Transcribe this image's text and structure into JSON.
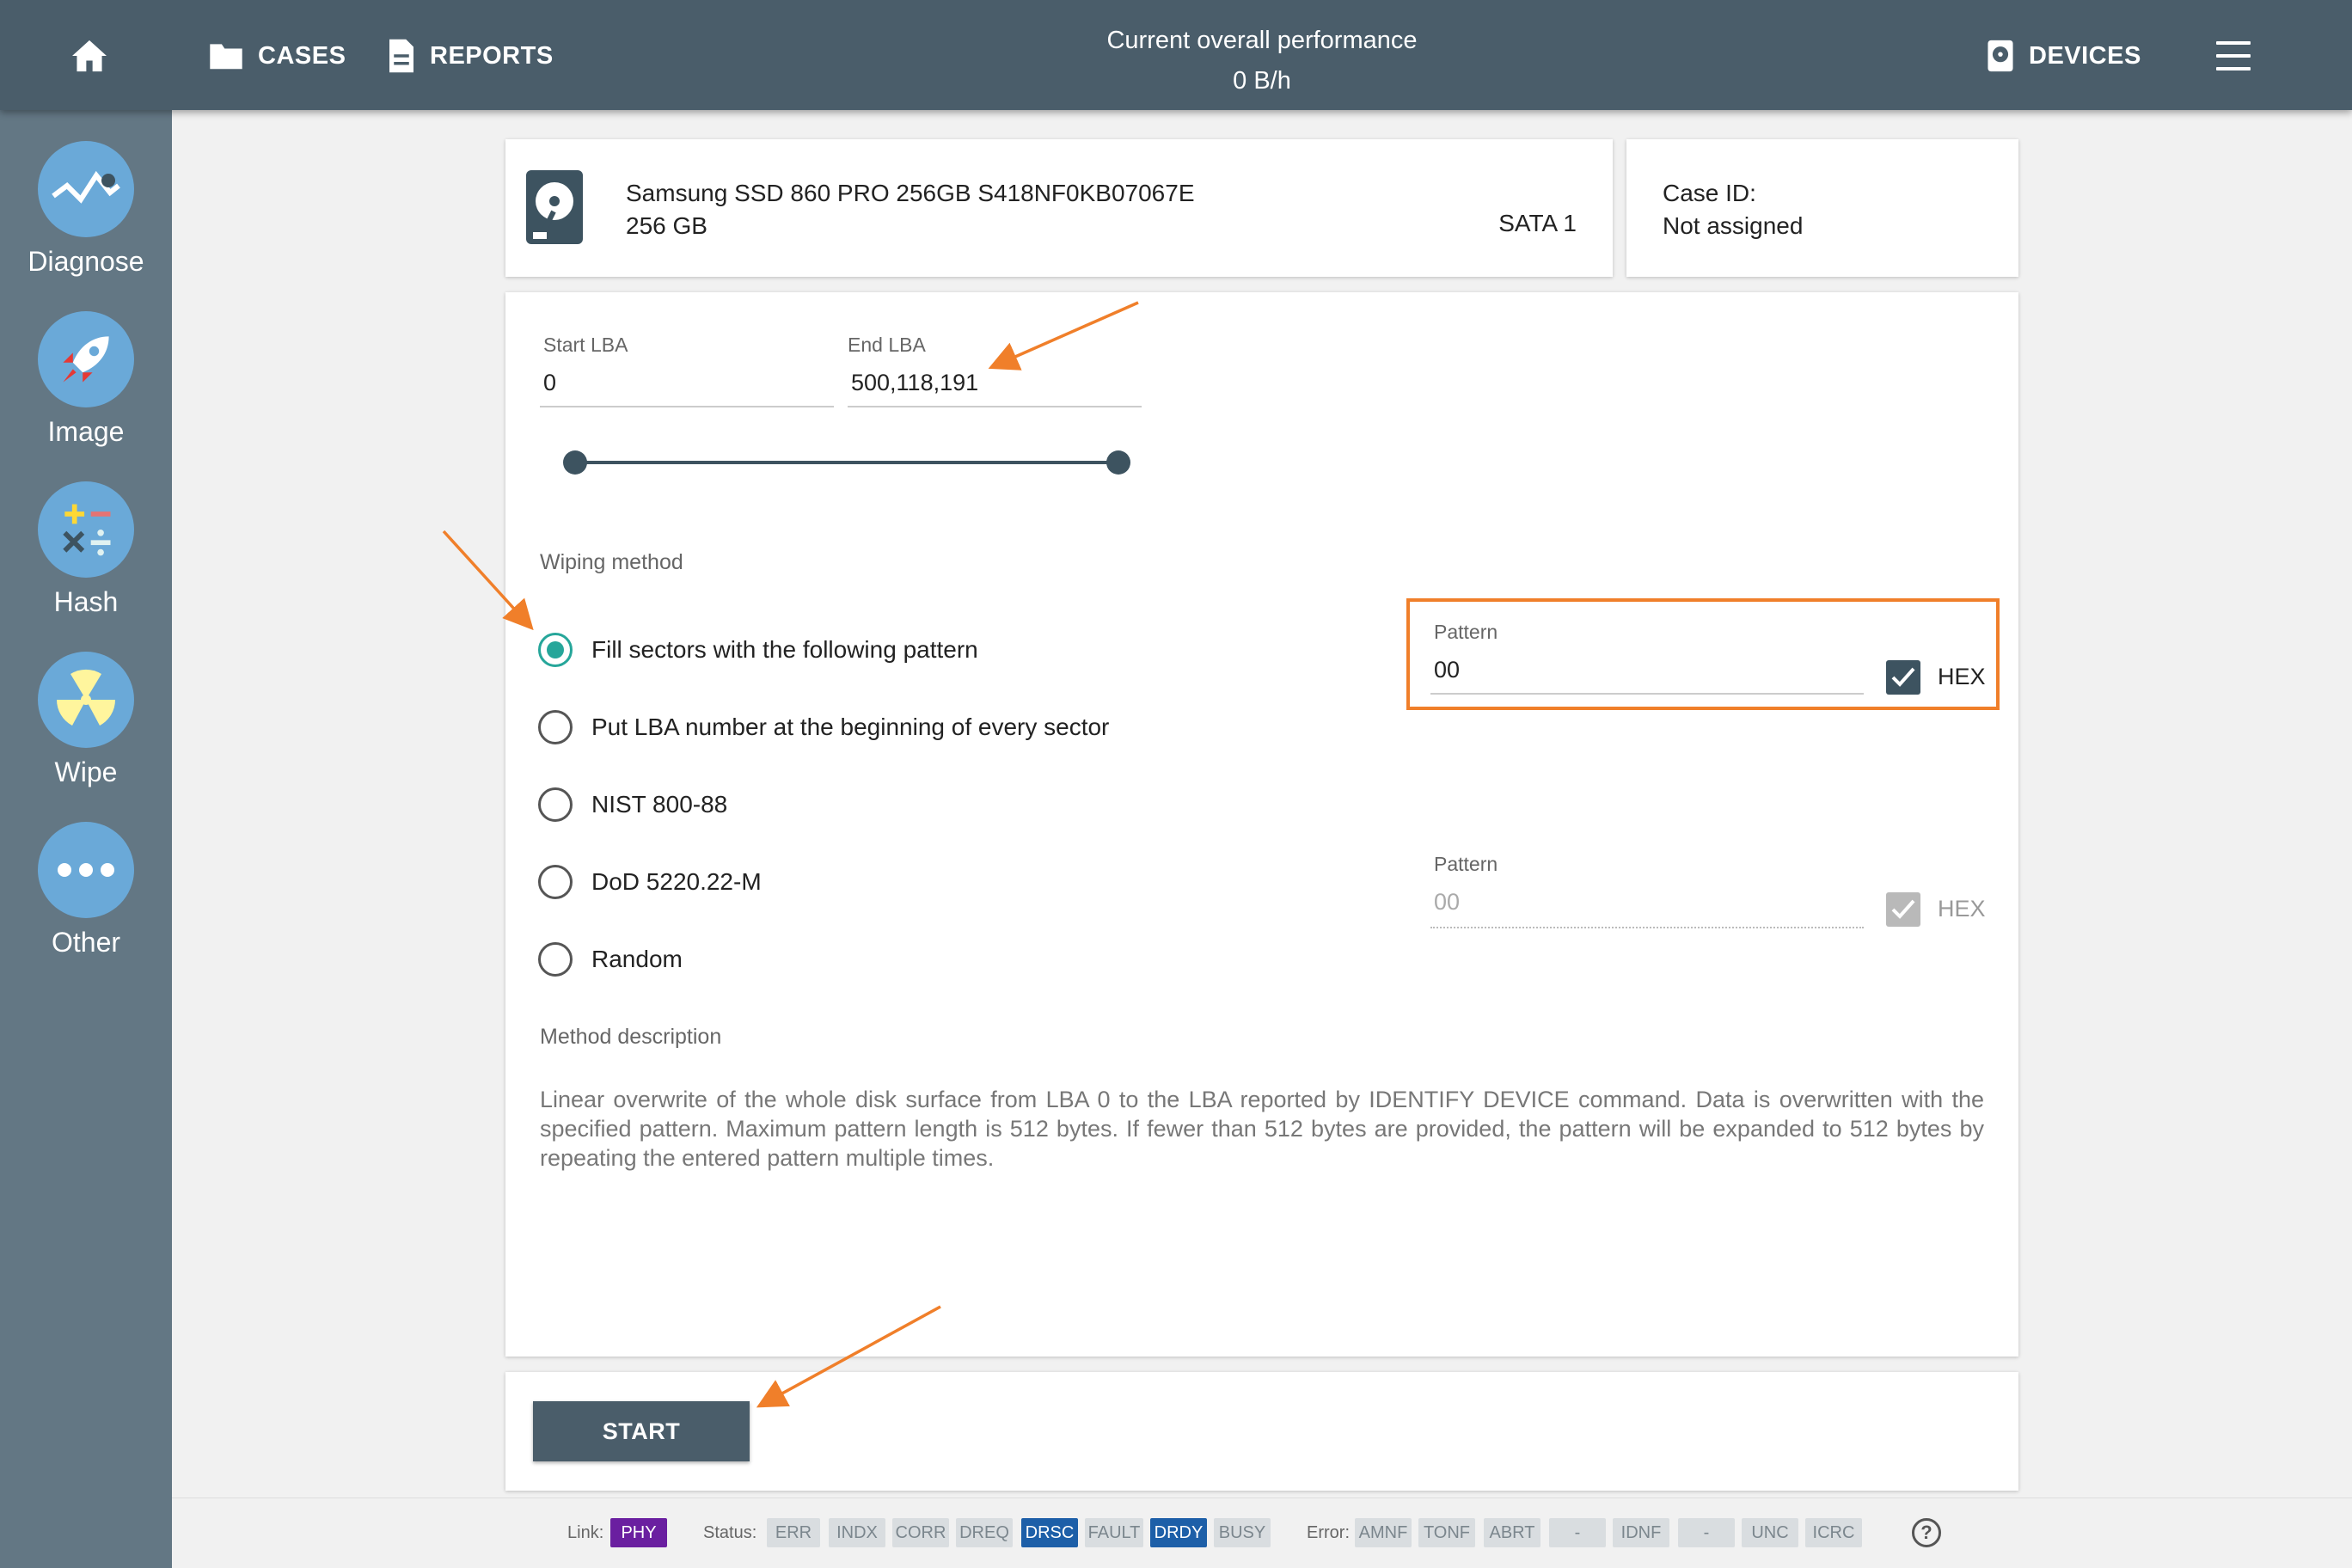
{
  "topbar": {
    "cases_label": "CASES",
    "reports_label": "REPORTS",
    "perf_title": "Current overall performance",
    "perf_value": "0 B/h",
    "devices_label": "DEVICES"
  },
  "sidebar": {
    "items": [
      {
        "label": "Diagnose",
        "icon": "diagnose-icon"
      },
      {
        "label": "Image",
        "icon": "rocket-icon"
      },
      {
        "label": "Hash",
        "icon": "calculator-icon"
      },
      {
        "label": "Wipe",
        "icon": "radiation-icon"
      },
      {
        "label": "Other",
        "icon": "more-dots-icon"
      }
    ]
  },
  "device": {
    "name": "Samsung SSD 860 PRO 256GB S418NF0KB07067E",
    "capacity": "256 GB",
    "port": "SATA 1"
  },
  "case": {
    "label": "Case ID:",
    "value": "Not assigned"
  },
  "lba": {
    "start_label": "Start LBA",
    "start_value": "0",
    "end_label": "End LBA",
    "end_value": "500,118,191",
    "range_fraction": [
      0,
      1
    ]
  },
  "wiping": {
    "label": "Wiping method",
    "options": [
      "Fill sectors with the following pattern",
      "Put LBA number at the beginning of every sector",
      "NIST 800-88",
      "DoD 5220.22-M",
      "Random"
    ],
    "selected_index": 0
  },
  "pattern_active": {
    "label": "Pattern",
    "value": "00",
    "hex_label": "HEX",
    "hex_checked": true
  },
  "pattern_disabled": {
    "label": "Pattern",
    "value": "00",
    "hex_label": "HEX",
    "hex_checked": true
  },
  "description": {
    "label": "Method description",
    "text": "Linear overwrite of the whole disk surface from LBA 0 to the LBA reported by IDENTIFY DEVICE command. Data is overwritten with the specified pattern. Maximum pattern length is 512 bytes. If fewer than 512 bytes are provided, the pattern will be expanded to 512 bytes by repeating the entered pattern multiple times."
  },
  "start_label": "START",
  "status": {
    "link_label": "Link:",
    "link_value": "PHY",
    "status_label": "Status:",
    "status_flags": [
      {
        "text": "ERR",
        "on": false
      },
      {
        "text": "INDX",
        "on": false
      },
      {
        "text": "CORR",
        "on": false
      },
      {
        "text": "DREQ",
        "on": false
      },
      {
        "text": "DRSC",
        "on": true
      },
      {
        "text": "FAULT",
        "on": false
      },
      {
        "text": "DRDY",
        "on": true
      },
      {
        "text": "BUSY",
        "on": false
      }
    ],
    "error_label": "Error:",
    "error_flags": [
      "AMNF",
      "TONF",
      "ABRT",
      "-",
      "IDNF",
      "-",
      "UNC",
      "ICRC"
    ],
    "help": "?"
  },
  "colors": {
    "topbar": "#4a5d6a",
    "sidebar": "#637784",
    "accent": "#26a69a",
    "highlight": "#f07f2a",
    "flag_on": "#1d5fa8",
    "link_badge": "#6a1fa0"
  }
}
